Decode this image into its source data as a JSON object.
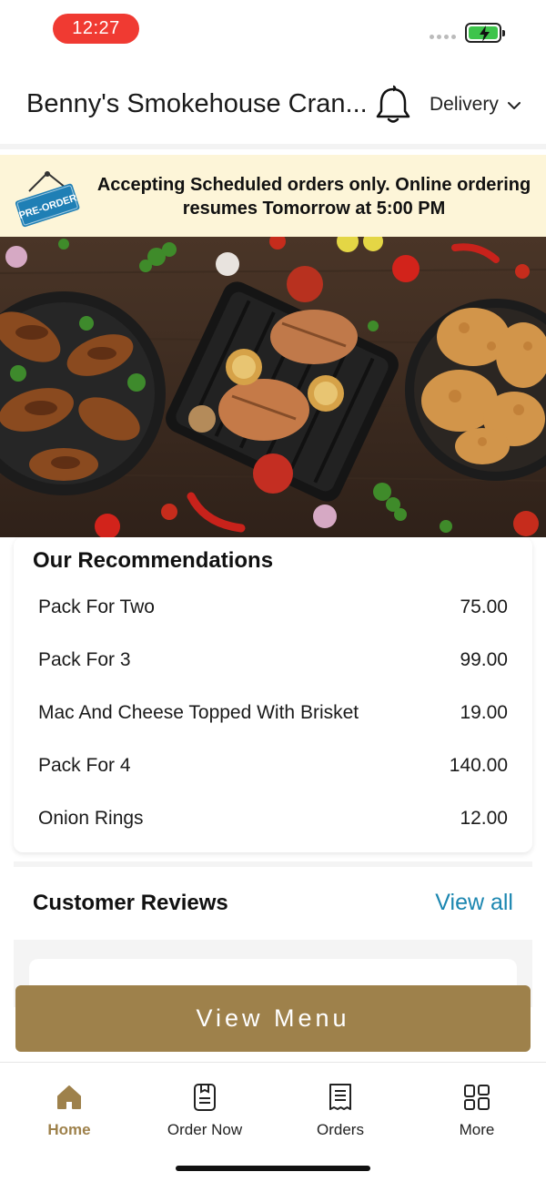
{
  "status_bar": {
    "time": "12:27",
    "battery_state": "charging",
    "battery_color": "#3ec44b"
  },
  "header": {
    "store_name": "Benny's Smokehouse Cran...",
    "delivery_mode": "Delivery",
    "icons": [
      "bell-icon",
      "chevron-down-icon"
    ]
  },
  "banner": {
    "badge": "PRE-ORDER",
    "message": "Accepting Scheduled orders only. Online ordering resumes Tomorrow at 5:00 PM"
  },
  "recommendations": {
    "title": "Our Recommendations",
    "items": [
      {
        "name": "Pack For Two",
        "price": "75.00"
      },
      {
        "name": "Pack For 3",
        "price": "99.00"
      },
      {
        "name": "Mac And Cheese Topped With Brisket",
        "price": "19.00"
      },
      {
        "name": "Pack For 4",
        "price": "140.00"
      },
      {
        "name": "Onion Rings",
        "price": "12.00"
      }
    ]
  },
  "reviews": {
    "title": "Customer Reviews",
    "view_all": "View all"
  },
  "cta": {
    "view_menu": "View Menu"
  },
  "bottom_nav": {
    "items": [
      {
        "label": "Home",
        "icon": "home-icon",
        "active": true
      },
      {
        "label": "Order Now",
        "icon": "order-icon",
        "active": false
      },
      {
        "label": "Orders",
        "icon": "receipt-icon",
        "active": false
      },
      {
        "label": "More",
        "icon": "grid-icon",
        "active": false
      }
    ]
  },
  "colors": {
    "accent": "#9e814b",
    "link": "#1b86b0",
    "banner_bg": "#fdf5d8",
    "time_pill": "#f03a32"
  }
}
